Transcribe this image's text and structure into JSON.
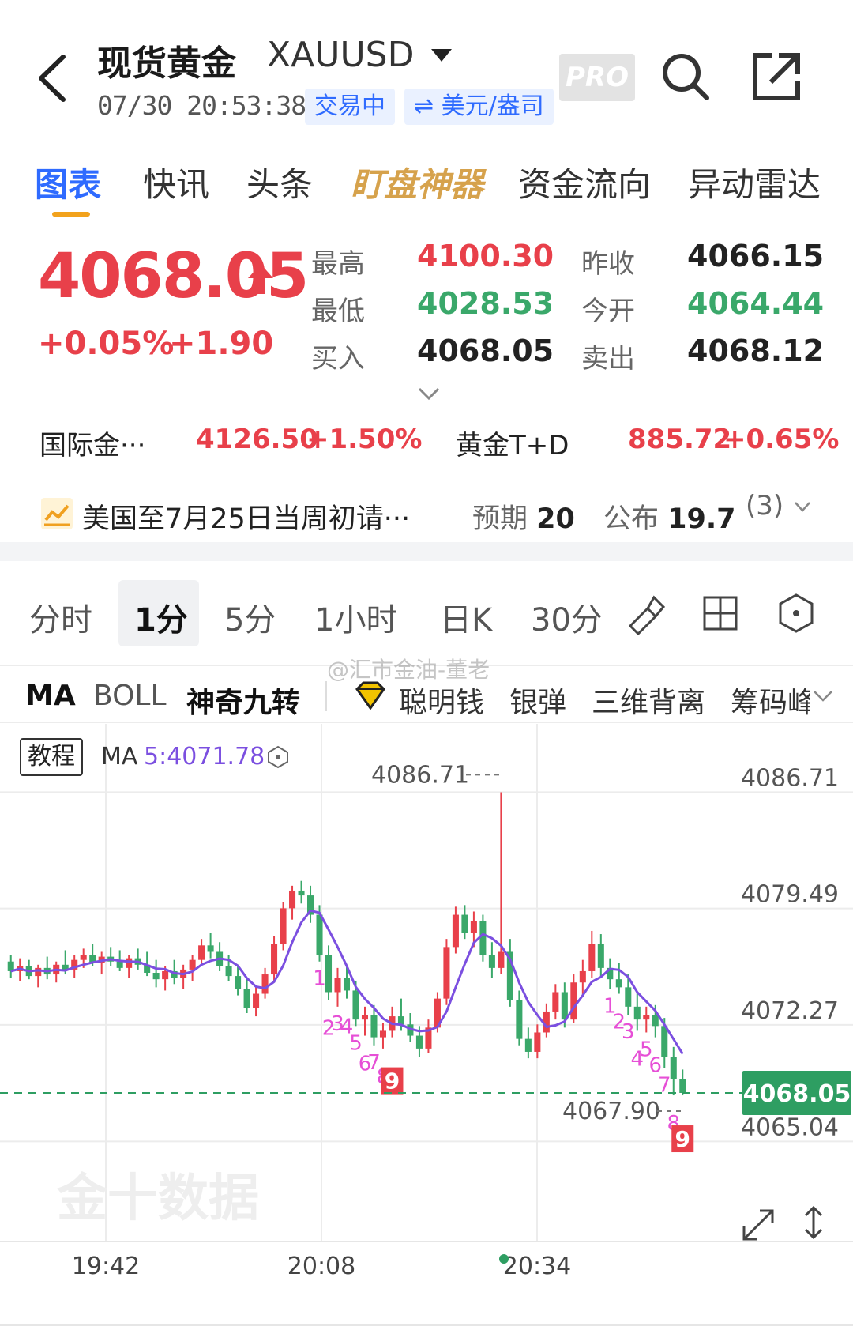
{
  "header": {
    "title": "现货黄金",
    "symbol": "XAUUSD",
    "datetime": "07/30 20:53:38",
    "status_badge": "交易中",
    "unit_badge": "⇌ 美元/盎司",
    "pro_label": "PRO"
  },
  "tabs": [
    {
      "label": "图表",
      "active": true
    },
    {
      "label": "快讯"
    },
    {
      "label": "头条"
    },
    {
      "label": "盯盘神器"
    },
    {
      "label": "资金流向"
    },
    {
      "label": "异动雷达"
    }
  ],
  "quote": {
    "price": "4068.05",
    "change_pct": "+0.05%",
    "change_abs": "+1.90",
    "high_label": "最高",
    "high": "4100.30",
    "low_label": "最低",
    "low": "4028.53",
    "bid_label": "买入",
    "bid": "4068.05",
    "prev_close_label": "昨收",
    "prev_close": "4066.15",
    "open_label": "今开",
    "open": "4064.44",
    "ask_label": "卖出",
    "ask": "4068.12"
  },
  "related": [
    {
      "name": "国际金···",
      "price": "4126.50",
      "change": "+1.50%"
    },
    {
      "name": "黄金T+D",
      "price": "885.72",
      "change": "+0.65%"
    }
  ],
  "news": {
    "title": "美国至7月25日当周初请···",
    "expected_label": "预期",
    "expected": "20",
    "actual_label": "公布",
    "actual": "19.7",
    "count": "(3)"
  },
  "periods": [
    {
      "label": "分时"
    },
    {
      "label": "1分",
      "active": true
    },
    {
      "label": "5分"
    },
    {
      "label": "1小时"
    },
    {
      "label": "日K"
    },
    {
      "label": "30分"
    }
  ],
  "indicators": [
    "MA",
    "BOLL",
    "神奇九转",
    "聪明钱",
    "银弹",
    "三维背离",
    "筹码峰"
  ],
  "watermark": "@汇市金油-董老",
  "chart": {
    "tutorial_label": "教程",
    "ma_label": "MA",
    "ma_value": "5:4071.78",
    "chart_watermark": "金十数据"
  },
  "colors": {
    "up": "#e8404a",
    "down": "#3aa86a",
    "accent": "#2f6bff",
    "ma_line": "#7b4fe0",
    "nine_turn": "#e64fd6"
  },
  "chart_data": {
    "type": "candlestick",
    "y_ticks": [
      "4086.71",
      "4079.49",
      "4072.27",
      "4065.04"
    ],
    "x_ticks": [
      "19:42",
      "20:08",
      "20:34"
    ],
    "max_marker": "4086.71",
    "min_marker": "4067.90",
    "current_price": "4068.05",
    "ylim": [
      4063.0,
      4088.0
    ],
    "ma5_last": 4071.78,
    "candles": [
      [
        4076.2,
        4076.6,
        4075.2,
        4075.6
      ],
      [
        4075.6,
        4076.4,
        4075.0,
        4075.9
      ],
      [
        4075.9,
        4076.3,
        4075.1,
        4075.3
      ],
      [
        4075.3,
        4076.0,
        4074.6,
        4075.8
      ],
      [
        4075.8,
        4076.5,
        4075.1,
        4075.4
      ],
      [
        4075.4,
        4076.2,
        4074.9,
        4076.0
      ],
      [
        4076.0,
        4076.9,
        4075.4,
        4075.7
      ],
      [
        4075.7,
        4076.6,
        4075.2,
        4076.3
      ],
      [
        4076.3,
        4077.0,
        4075.8,
        4076.6
      ],
      [
        4076.6,
        4077.3,
        4075.9,
        4076.1
      ],
      [
        4076.1,
        4076.8,
        4075.4,
        4076.5
      ],
      [
        4076.5,
        4077.1,
        4075.9,
        4076.2
      ],
      [
        4076.2,
        4076.9,
        4075.6,
        4075.8
      ],
      [
        4075.8,
        4076.6,
        4075.2,
        4076.4
      ],
      [
        4076.4,
        4077.0,
        4075.7,
        4076.0
      ],
      [
        4076.0,
        4076.8,
        4075.3,
        4075.5
      ],
      [
        4075.5,
        4076.3,
        4074.6,
        4075.1
      ],
      [
        4075.1,
        4075.9,
        4074.4,
        4075.6
      ],
      [
        4075.6,
        4076.3,
        4074.8,
        4075.2
      ],
      [
        4075.2,
        4076.0,
        4074.5,
        4075.7
      ],
      [
        4075.7,
        4076.6,
        4075.0,
        4076.3
      ],
      [
        4076.3,
        4077.6,
        4075.9,
        4077.2
      ],
      [
        4077.2,
        4078.0,
        4076.4,
        4076.8
      ],
      [
        4076.8,
        4077.4,
        4075.6,
        4075.9
      ],
      [
        4075.9,
        4076.6,
        4075.0,
        4075.3
      ],
      [
        4075.3,
        4075.9,
        4074.1,
        4074.5
      ],
      [
        4074.5,
        4075.2,
        4073.0,
        4073.3
      ],
      [
        4073.3,
        4074.6,
        4072.8,
        4074.2
      ],
      [
        4074.2,
        4075.8,
        4073.9,
        4075.4
      ],
      [
        4075.4,
        4077.8,
        4075.0,
        4077.3
      ],
      [
        4077.3,
        4079.9,
        4076.9,
        4079.5
      ],
      [
        4079.5,
        4080.9,
        4078.8,
        4080.6
      ],
      [
        4080.6,
        4081.2,
        4079.8,
        4080.3
      ],
      [
        4080.3,
        4080.9,
        4078.6,
        4079.1
      ],
      [
        4079.1,
        4079.7,
        4076.2,
        4076.6
      ],
      [
        4076.6,
        4077.2,
        4073.8,
        4074.3
      ],
      [
        4074.3,
        4075.8,
        4073.4,
        4075.2
      ],
      [
        4075.2,
        4076.0,
        4073.9,
        4074.4
      ],
      [
        4074.4,
        4075.0,
        4072.2,
        4072.6
      ],
      [
        4072.6,
        4073.4,
        4071.6,
        4072.9
      ],
      [
        4072.9,
        4073.5,
        4071.0,
        4071.5
      ],
      [
        4071.5,
        4072.4,
        4070.8,
        4071.9
      ],
      [
        4071.9,
        4073.4,
        4071.5,
        4072.8
      ],
      [
        4072.8,
        4073.9,
        4071.9,
        4072.3
      ],
      [
        4072.3,
        4073.0,
        4071.2,
        4071.6
      ],
      [
        4071.6,
        4072.2,
        4070.3,
        4070.8
      ],
      [
        4070.8,
        4072.6,
        4070.5,
        4072.1
      ],
      [
        4072.1,
        4074.3,
        4071.8,
        4073.9
      ],
      [
        4073.9,
        4077.6,
        4073.5,
        4077.1
      ],
      [
        4077.1,
        4079.6,
        4076.7,
        4079.1
      ],
      [
        4079.1,
        4079.7,
        4077.6,
        4078.0
      ],
      [
        4078.0,
        4079.3,
        4077.1,
        4078.7
      ],
      [
        4078.7,
        4079.1,
        4076.2,
        4076.6
      ],
      [
        4076.6,
        4077.4,
        4075.2,
        4075.8
      ],
      [
        4075.8,
        4086.7,
        4075.4,
        4076.8
      ],
      [
        4076.8,
        4077.6,
        4073.4,
        4073.8
      ],
      [
        4073.8,
        4074.4,
        4071.0,
        4071.4
      ],
      [
        4071.4,
        4072.1,
        4070.2,
        4070.6
      ],
      [
        4070.6,
        4072.3,
        4070.2,
        4071.8
      ],
      [
        4071.8,
        4073.6,
        4071.5,
        4073.1
      ],
      [
        4073.1,
        4074.8,
        4072.6,
        4074.3
      ],
      [
        4074.3,
        4074.9,
        4072.1,
        4072.6
      ],
      [
        4072.6,
        4075.4,
        4072.4,
        4074.9
      ],
      [
        4074.9,
        4076.3,
        4074.0,
        4075.6
      ],
      [
        4075.6,
        4078.1,
        4075.2,
        4077.3
      ],
      [
        4077.3,
        4077.9,
        4075.3,
        4075.8
      ],
      [
        4075.8,
        4076.4,
        4074.5,
        4075.1
      ],
      [
        4075.1,
        4076.1,
        4074.2,
        4074.6
      ],
      [
        4074.6,
        4075.4,
        4072.9,
        4073.4
      ],
      [
        4073.4,
        4074.3,
        4071.9,
        4072.6
      ],
      [
        4072.6,
        4073.4,
        4071.8,
        4072.9
      ],
      [
        4072.9,
        4073.5,
        4071.5,
        4072.2
      ],
      [
        4072.2,
        4072.7,
        4069.6,
        4070.3
      ],
      [
        4070.3,
        4070.9,
        4067.9,
        4068.9
      ],
      [
        4068.9,
        4069.5,
        4067.9,
        4068.05
      ]
    ],
    "nine_turn_seq_1": [
      "1",
      "2",
      "3",
      "4",
      "5",
      "6",
      "7",
      "8",
      "9"
    ],
    "nine_turn_seq_2": [
      "1",
      "2",
      "3",
      "4",
      "5",
      "6",
      "7",
      "8",
      "9"
    ]
  }
}
